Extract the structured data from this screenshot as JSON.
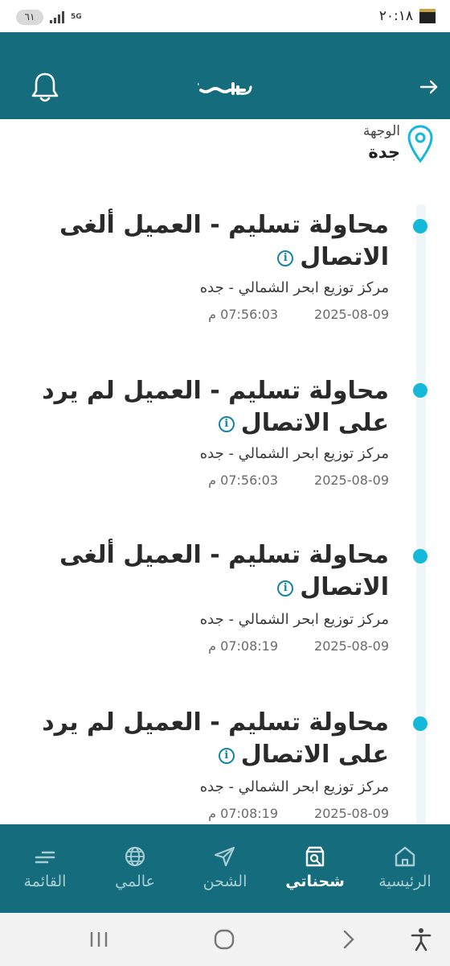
{
  "status_bar": {
    "battery": "٦١",
    "network": "5G",
    "time": "٢٠:١٨"
  },
  "header": {
    "logo_text": "SPL سبل"
  },
  "destination": {
    "label": "الوجهة",
    "value": "جدة"
  },
  "events": [
    {
      "title": "محاولة تسليم - العميل ألغى الاتصال",
      "location": "مركز توزيع ابحر الشمالي - جده",
      "date": "2025-08-09",
      "time": "07:56:03 م"
    },
    {
      "title": "محاولة تسليم - العميل لم يرد على الاتصال",
      "location": "مركز توزيع ابحر الشمالي - جده",
      "date": "2025-08-09",
      "time": "07:56:03 م"
    },
    {
      "title": "محاولة تسليم - العميل ألغى الاتصال",
      "location": "مركز توزيع ابحر الشمالي - جده",
      "date": "2025-08-09",
      "time": "07:08:19 م"
    },
    {
      "title": "محاولة تسليم - العميل لم يرد على الاتصال",
      "location": "مركز توزيع ابحر الشمالي - جده",
      "date": "2025-08-09",
      "time": "07:08:19 م"
    }
  ],
  "bottom_nav": [
    {
      "label": "الرئيسية",
      "icon": "home-icon",
      "active": false
    },
    {
      "label": "شحناتي",
      "icon": "package-search-icon",
      "active": true
    },
    {
      "label": "الشحن",
      "icon": "send-icon",
      "active": false
    },
    {
      "label": "عالمي",
      "icon": "globe-icon",
      "active": false
    },
    {
      "label": "القائمة",
      "icon": "menu-icon",
      "active": false
    }
  ],
  "colors": {
    "primary": "#146c7c",
    "accent": "#14b8d8",
    "info": "#1583a4"
  }
}
